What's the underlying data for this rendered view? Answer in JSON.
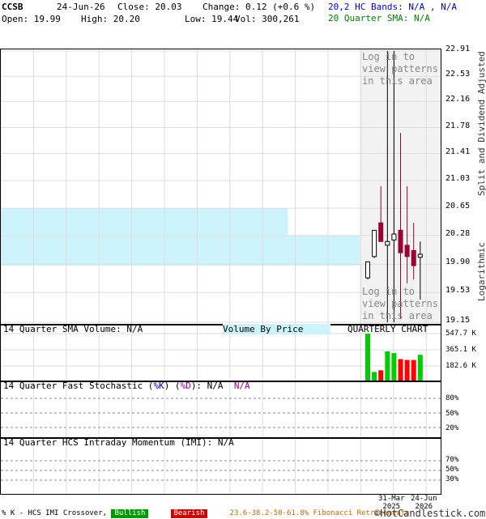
{
  "header": {
    "symbol": "CCSB",
    "date": "24-Jun-26",
    "close_label": "Close: 20.03",
    "change_label": "Change: 0.12 (+0.6 %)",
    "open_label": "Open: 19.99",
    "high_label": "High: 20.20",
    "low_label": "Low: 19.44",
    "vol_label": "Vol: 300,261",
    "hc_bands": "20,2 HC Bands: N/A , N/A",
    "sma_label": "20 Quarter SMA: N/A"
  },
  "colors": {
    "hc_bands": "#0000cc",
    "sma": "#008000",
    "up_candle": "#ffffff",
    "down_candle": "#990033",
    "volume_green": "#00cc00",
    "volume_red": "#ff0000",
    "band_fill": "#ccf3fb",
    "stoch_d": "#990099",
    "bullish": "#009900",
    "bearish": "#cc0000",
    "fib": "#cc6600"
  },
  "price_panel": {
    "right_label": "Split and Dividend Adjusted",
    "log_label": "Logarithmic",
    "login_top": "Log in to\nview patterns\nin this area",
    "login_bottom": "Log in to\nview patterns\nin this area"
  },
  "volume_panel": {
    "title": "14 Quarter SMA Volume: N/A",
    "vbp_label": "Volume By Price",
    "chart_label": "QUARTERLY CHART",
    "ticks": [
      "547.7 K",
      "365.1 K",
      "182.6 K"
    ]
  },
  "stoch_panel": {
    "title_prefix": "14 Quarter Fast Stochastic (",
    "k_label": "%K",
    "sep": ") (",
    "d_label": "%D",
    "title_suffix": "): N/A",
    "d_value": "N/A",
    "ticks": [
      "80%",
      "50%",
      "20%"
    ]
  },
  "imi_panel": {
    "title": "14 Quarter HCS Intraday Momentum (IMI): N/A",
    "ticks": [
      "70%",
      "50%",
      "30%"
    ]
  },
  "x_axis": {
    "dates": [
      {
        "top": "31-Mar",
        "bottom": "2025"
      },
      {
        "top": "24-Jun",
        "bottom": "2026"
      }
    ]
  },
  "footer": {
    "crossover": "% K - HCS IMI Crossover,",
    "bullish": "Bullish",
    "bearish": "Bearish",
    "fib": "23.6-38.2-50-61.8% Fibonacci Retracements",
    "brand": "©HotCandlestick.com"
  },
  "chart_data": {
    "type": "candlestick",
    "scale": "log",
    "y_ticks": [
      22.91,
      22.53,
      22.16,
      21.78,
      21.41,
      21.03,
      20.65,
      20.28,
      19.9,
      19.53,
      19.15
    ],
    "ylim": [
      19.15,
      22.91
    ],
    "candles": [
      {
        "open": 19.72,
        "high": 19.93,
        "low": 19.7,
        "close": 19.93,
        "vol": 547700
      },
      {
        "open": 20.0,
        "high": 20.35,
        "low": 19.98,
        "close": 20.35,
        "vol": 100000
      },
      {
        "open": 20.45,
        "high": 20.95,
        "low": 20.2,
        "close": 20.2,
        "vol": 120000
      },
      {
        "open": 20.15,
        "high": 22.91,
        "low": 19.15,
        "close": 20.2,
        "vol": 340000
      },
      {
        "open": 20.22,
        "high": 22.91,
        "low": 19.15,
        "close": 20.3,
        "vol": 320000
      },
      {
        "open": 20.35,
        "high": 21.7,
        "low": 19.2,
        "close": 20.05,
        "vol": 250000
      },
      {
        "open": 20.15,
        "high": 20.95,
        "low": 19.65,
        "close": 20.0,
        "vol": 240000
      },
      {
        "open": 20.08,
        "high": 20.45,
        "low": 19.7,
        "close": 19.88,
        "vol": 240000
      },
      {
        "open": 19.99,
        "high": 20.2,
        "low": 19.44,
        "close": 20.03,
        "vol": 300261
      }
    ],
    "bands": [
      {
        "from_price": 20.28,
        "to_price": 20.65,
        "extent": 0.59
      },
      {
        "from_price": 19.88,
        "to_price": 20.28,
        "extent": 1.0
      }
    ]
  }
}
